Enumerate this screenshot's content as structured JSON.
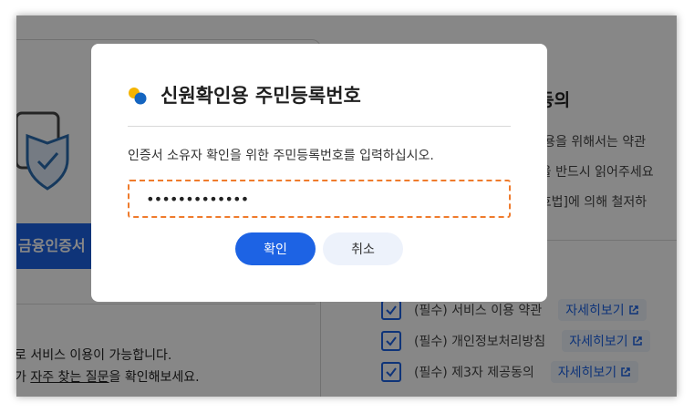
{
  "background": {
    "cert_button_label": "금융인증서",
    "info_line1": "로 서비스 이용이 가능합니다.",
    "info_line2_prefix": "가 ",
    "info_line2_link": "자주 찾는 질문",
    "info_line2_suffix": "을 확인해보세요.",
    "right_title": "관 동의",
    "right_paragraph": [
      "스 이용을 위해서는 약관",
      "내문을 반드시 읽어주세요",
      "보보호법]에 의해 철저하"
    ],
    "consents": [
      {
        "label": "(필수) 서비스 이용 약관",
        "detail": "자세히보기"
      },
      {
        "label": "(필수) 개인정보처리방침",
        "detail": "자세히보기"
      },
      {
        "label": "(필수) 제3자 제공동의",
        "detail": "자세히보기"
      }
    ]
  },
  "modal": {
    "title": "신원확인용 주민등록번호",
    "description": "인증서 소유자 확인을 위한 주민등록번호를 입력하십시오.",
    "password_value": "•••••••••••••",
    "confirm_label": "확인",
    "cancel_label": "취소",
    "icon": "dots-logo-icon",
    "icon_colors": {
      "yellow": "#f5b400",
      "blue": "#1565c0"
    }
  },
  "colors": {
    "primary": "#1d63e4",
    "input_border": "#ef7b2c",
    "cancel_bg": "#edf2fb"
  }
}
